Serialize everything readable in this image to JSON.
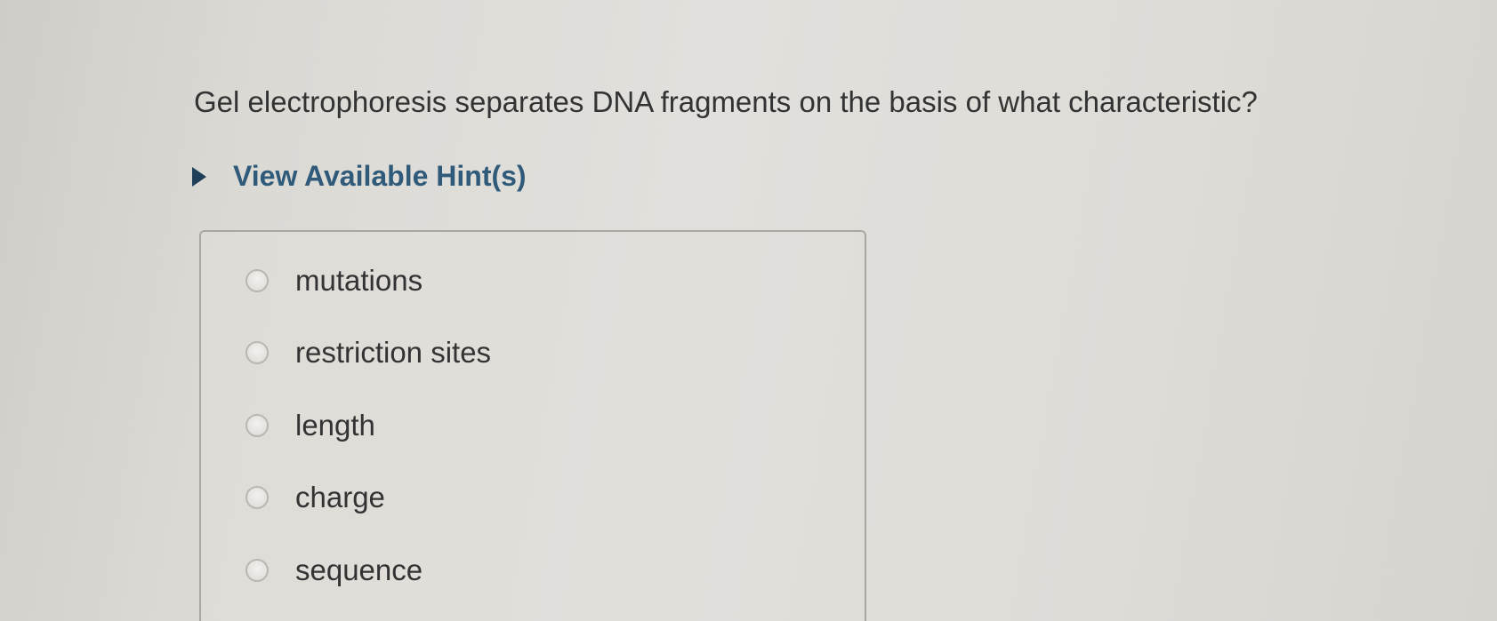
{
  "question": {
    "text": "Gel electrophoresis separates DNA fragments on the basis of what characteristic?"
  },
  "hints": {
    "label": "View Available Hint(s)"
  },
  "options": [
    {
      "label": "mutations"
    },
    {
      "label": "restriction sites"
    },
    {
      "label": "length"
    },
    {
      "label": "charge"
    },
    {
      "label": "sequence"
    }
  ],
  "colors": {
    "hint_text": "#2f5a7a",
    "hint_arrow": "#1f3f58",
    "body_text": "#333333",
    "box_border": "#a9a7a2"
  },
  "icons": {
    "hint_toggle": "triangle-right-icon",
    "option_marker": "radio-button-icon"
  }
}
